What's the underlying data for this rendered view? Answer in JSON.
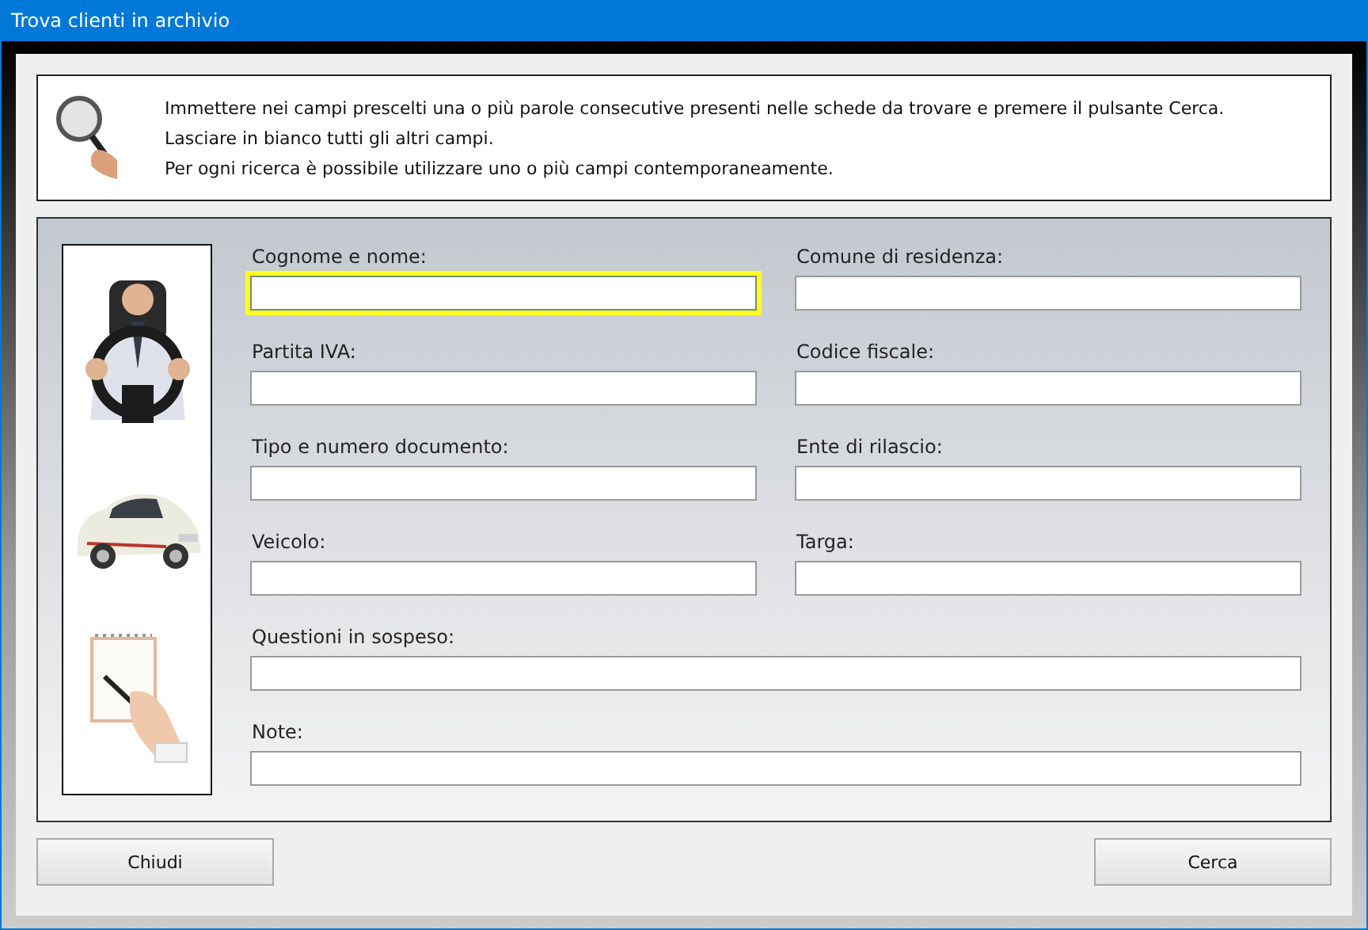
{
  "window": {
    "title": "Trova clienti in archivio"
  },
  "info": {
    "lines": [
      "Immettere nei campi prescelti una o più parole consecutive presenti nelle schede da trovare e premere il pulsante Cerca.",
      "Lasciare in bianco tutti gli altri campi.",
      "Per ogni ricerca è possibile utilizzare uno o più campi contemporaneamente."
    ]
  },
  "fields": [
    {
      "label": "Cognome e nome:",
      "kind": "half",
      "focused": true
    },
    {
      "label": "Comune di residenza:",
      "kind": "half",
      "focused": false
    },
    {
      "label": "Partita IVA:",
      "kind": "half",
      "focused": false
    },
    {
      "label": "Codice fiscale:",
      "kind": "half",
      "focused": false
    },
    {
      "label": "Tipo e numero documento:",
      "kind": "half",
      "focused": false
    },
    {
      "label": "Ente di rilascio:",
      "kind": "half",
      "focused": false
    },
    {
      "label": "Veicolo:",
      "kind": "half",
      "focused": false
    },
    {
      "label": "Targa:",
      "kind": "half",
      "focused": false
    },
    {
      "label": "Questioni in sospeso:",
      "kind": "full",
      "focused": false
    },
    {
      "label": "Note:",
      "kind": "full",
      "focused": false
    }
  ],
  "buttons": [
    {
      "label": "Chiudi"
    },
    {
      "label": "Cerca"
    }
  ]
}
